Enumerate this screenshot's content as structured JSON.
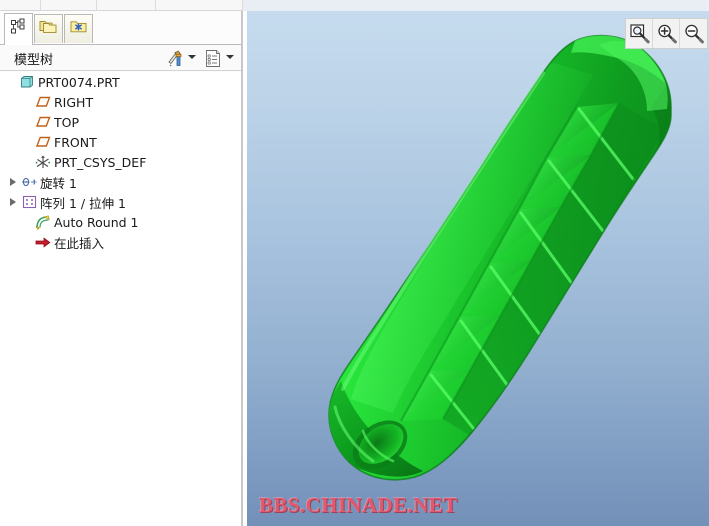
{
  "app": {
    "title": "Pro/ENGINEER Model Tree",
    "watermark": "BBS.CHINADE.NET"
  },
  "tabs": [
    {
      "id": "model-tree",
      "icon": "hierarchy-icon",
      "label": "Model Tree",
      "active": true
    },
    {
      "id": "folder-browser",
      "icon": "folders-icon",
      "label": "Folder Browser",
      "active": false
    },
    {
      "id": "favorites",
      "icon": "folder-star-icon",
      "label": "Favorites",
      "active": false
    }
  ],
  "tree_header": {
    "title": "模型树",
    "settings_icon": "tools-icon",
    "settings_caret": "chevron-down-icon",
    "display_icon": "list-settings-icon",
    "display_caret": "chevron-down-icon"
  },
  "tree": {
    "items": [
      {
        "label": "PRT0074.PRT",
        "icon": "part-icon",
        "indent": 0,
        "expander": false
      },
      {
        "label": "RIGHT",
        "icon": "datum-plane-icon",
        "indent": 1,
        "expander": false
      },
      {
        "label": "TOP",
        "icon": "datum-plane-icon",
        "indent": 1,
        "expander": false
      },
      {
        "label": "FRONT",
        "icon": "datum-plane-icon",
        "indent": 1,
        "expander": false
      },
      {
        "label": "PRT_CSYS_DEF",
        "icon": "csys-icon",
        "indent": 1,
        "expander": false
      },
      {
        "label": "旋转 1",
        "icon": "revolve-icon",
        "indent": 1,
        "expander": true
      },
      {
        "label": "阵列 1 / 拉伸 1",
        "icon": "pattern-icon",
        "indent": 1,
        "expander": true
      },
      {
        "label": "Auto Round 1",
        "icon": "auto-round-icon",
        "indent": 1,
        "expander": false
      },
      {
        "label": "在此插入",
        "icon": "insert-here-icon",
        "indent": 1,
        "expander": false
      }
    ]
  },
  "viewport": {
    "zoom_buttons": [
      {
        "id": "zoom-area",
        "icon": "zoom-area-icon",
        "label": "Zoom In Area"
      },
      {
        "id": "zoom-in",
        "icon": "zoom-in-icon",
        "label": "Zoom In"
      },
      {
        "id": "zoom-out",
        "icon": "zoom-out-icon",
        "label": "Zoom Out"
      }
    ],
    "model_name": "diamond-knurled-grip",
    "model_color": "#22d53a",
    "background_top": "#c6dbee",
    "background_bottom": "#7391b8"
  }
}
